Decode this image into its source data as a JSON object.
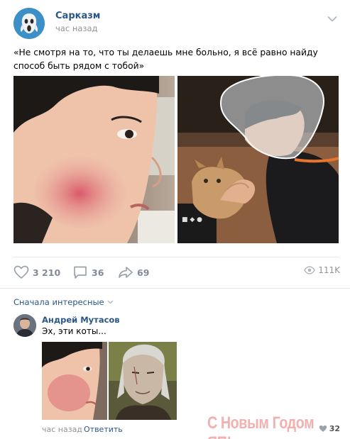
{
  "post": {
    "author": "Сарказм",
    "time": "час назад",
    "text": "«Не смотря на то, что ты делаешь мне больно, я всё равно найду способ быть рядом с тобой»",
    "photos": [
      "boy-with-red-cheek-photo",
      "boy-with-bucket-and-cat-photo"
    ],
    "actions": {
      "likes": "3 210",
      "comments": "36",
      "shares": "69",
      "views": "111K"
    },
    "icons": {
      "avatar": "scream-face-icon",
      "menu": "chevron-down-icon",
      "like": "heart-icon",
      "comment": "comment-bubble-icon",
      "share": "share-arrow-icon",
      "views": "eye-icon"
    },
    "colors": {
      "link": "#2a5885",
      "muted": "#828a99"
    }
  },
  "comments": {
    "sort_label": "Сначала интересные",
    "items": [
      {
        "author": "Андрей Мутасов",
        "text": "Эх, эти коты...",
        "time": "час назад",
        "reply_label": "Ответить",
        "likes": "32"
      }
    ]
  },
  "watermark": "С Новым Годом ЯП!"
}
